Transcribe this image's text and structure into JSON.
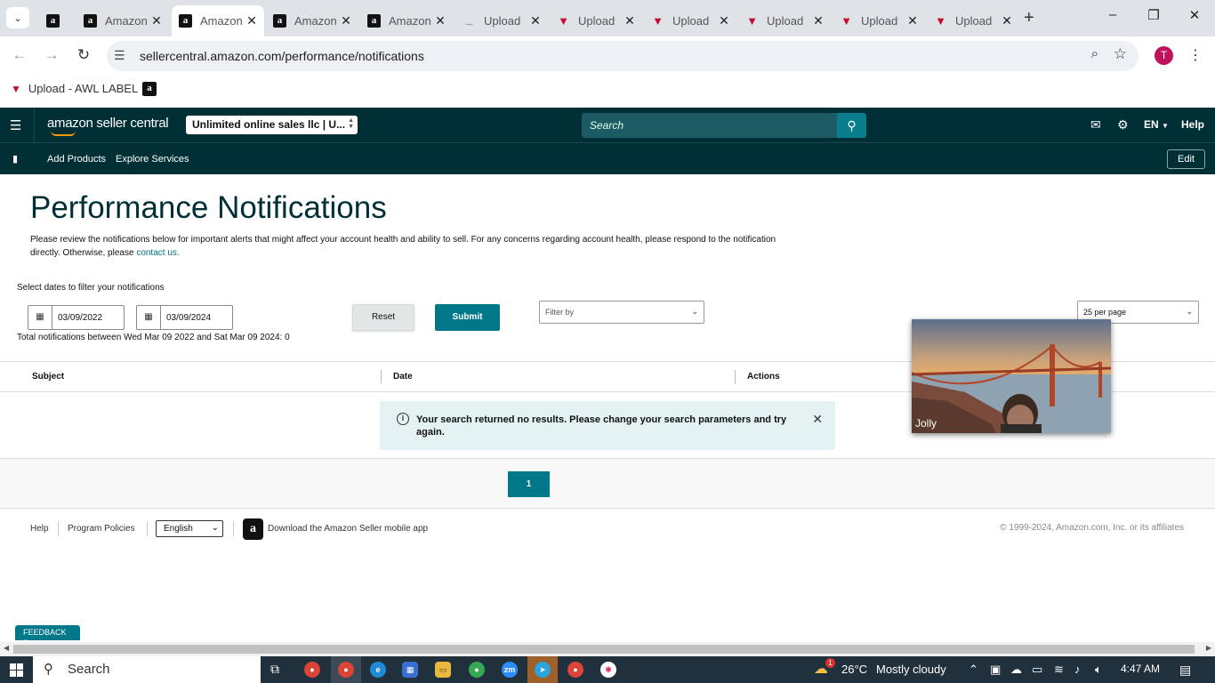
{
  "browser": {
    "tabs": [
      {
        "title": "",
        "icon": "amazon-icon",
        "active": false
      },
      {
        "title": "Amazon",
        "icon": "amazon-icon",
        "active": false
      },
      {
        "title": "Amazon",
        "icon": "amazon-icon",
        "active": true
      },
      {
        "title": "Amazon",
        "icon": "amazon-icon",
        "active": false
      },
      {
        "title": "Amazon",
        "icon": "amazon-icon",
        "active": false
      },
      {
        "title": "Upload",
        "icon": "loading-icon",
        "active": false
      },
      {
        "title": "Upload",
        "icon": "awl-icon",
        "active": false
      },
      {
        "title": "Upload",
        "icon": "awl-icon",
        "active": false
      },
      {
        "title": "Upload",
        "icon": "awl-icon",
        "active": false
      },
      {
        "title": "Upload",
        "icon": "awl-icon",
        "active": false
      },
      {
        "title": "Upload",
        "icon": "awl-icon",
        "active": false
      }
    ],
    "url": "sellercentral.amazon.com/performance/notifications",
    "profile_initial": "T",
    "bookmarks": [
      {
        "label": "Upload - AWL LABEL",
        "icon": "awl-icon"
      },
      {
        "label": "",
        "icon": "amazon-icon"
      }
    ]
  },
  "header": {
    "logo_text": "amazon seller central",
    "account": "Unlimited online sales llc | U...",
    "search_placeholder": "Search",
    "language": "EN",
    "help": "Help",
    "nav": {
      "add_products": "Add Products",
      "explore_services": "Explore Services",
      "edit": "Edit"
    }
  },
  "page": {
    "title": "Performance Notifications",
    "intro": "Please review the notifications below for important alerts that might affect your account health and ability to sell. For any concerns regarding account health, please respond to the notification directly. Otherwise, please",
    "contact_link": "contact us.",
    "filter_label": "Select dates to filter your notifications",
    "date_from": "03/09/2022",
    "date_to": "03/09/2024",
    "reset": "Reset",
    "submit": "Submit",
    "filter_by": "Filter by",
    "per_page": "25 per page",
    "total": "Total notifications between Wed Mar 09 2022 and Sat Mar 09 2024: 0",
    "columns": [
      "Subject",
      "Date",
      "Actions"
    ],
    "no_results": "Your search returned no results. Please change your search parameters and try again.",
    "page_number": "1"
  },
  "footer": {
    "help": "Help",
    "program_policies": "Program Policies",
    "language": "English",
    "app_download": "Download the Amazon Seller mobile app",
    "copyright": "© 1999-2024, Amazon.com, Inc. or its affiliates"
  },
  "video": {
    "name": "Jolly"
  },
  "feedback": "FEEDBACK",
  "taskbar": {
    "search": "Search",
    "weather_badge": "1",
    "temperature": "26°C",
    "weather": "Mostly cloudy",
    "time": "4:47 AM"
  }
}
